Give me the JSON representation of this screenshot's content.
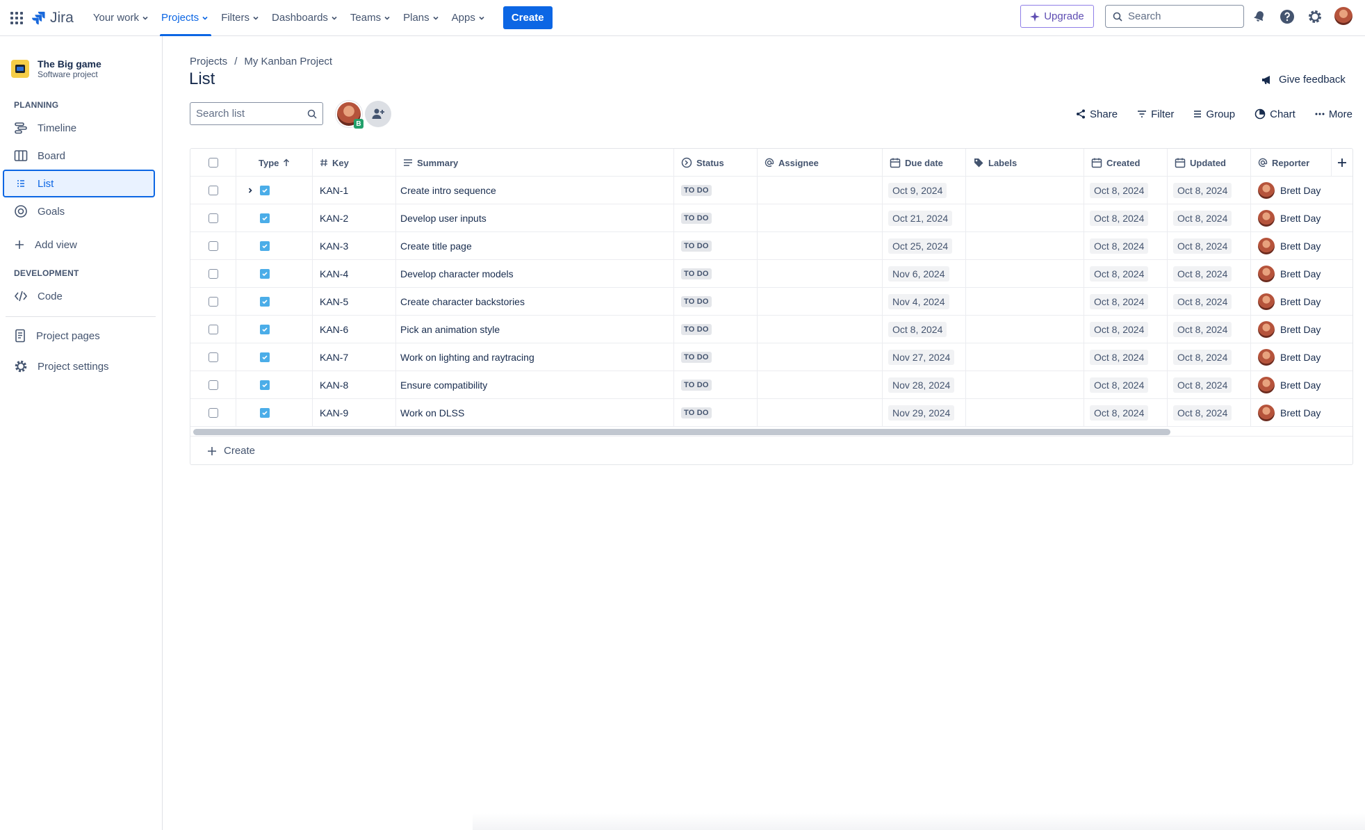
{
  "topnav": {
    "logo": "Jira",
    "items": [
      {
        "label": "Your work",
        "active": false
      },
      {
        "label": "Projects",
        "active": true
      },
      {
        "label": "Filters",
        "active": false
      },
      {
        "label": "Dashboards",
        "active": false
      },
      {
        "label": "Teams",
        "active": false
      },
      {
        "label": "Plans",
        "active": false
      },
      {
        "label": "Apps",
        "active": false
      }
    ],
    "create_label": "Create",
    "upgrade_label": "Upgrade",
    "search_placeholder": "Search"
  },
  "sidebar": {
    "project_name": "The Big game",
    "project_type": "Software project",
    "planning_heading": "PLANNING",
    "planning_items": [
      {
        "label": "Timeline",
        "icon": "timeline-icon"
      },
      {
        "label": "Board",
        "icon": "board-icon"
      },
      {
        "label": "List",
        "icon": "list-icon",
        "selected": true
      },
      {
        "label": "Goals",
        "icon": "goals-icon"
      }
    ],
    "add_view_label": "Add view",
    "development_heading": "DEVELOPMENT",
    "code_label": "Code",
    "project_pages_label": "Project pages",
    "project_settings_label": "Project settings"
  },
  "main": {
    "breadcrumb": [
      "Projects",
      "/",
      "My Kanban Project"
    ],
    "title": "List",
    "feedback_label": "Give feedback",
    "search_placeholder": "Search list",
    "avatar_badge": "B",
    "toolbar": [
      "Share",
      "Filter",
      "Group",
      "Chart",
      "More"
    ]
  },
  "table": {
    "columns": [
      "Type",
      "Key",
      "Summary",
      "Status",
      "Assignee",
      "Due date",
      "Labels",
      "Created",
      "Updated",
      "Reporter"
    ],
    "rows": [
      {
        "key": "KAN-1",
        "summary": "Create intro sequence",
        "status": "TO DO",
        "due": "Oct 9, 2024",
        "created": "Oct 8, 2024",
        "updated": "Oct 8, 2024",
        "reporter": "Brett Day"
      },
      {
        "key": "KAN-2",
        "summary": "Develop user inputs",
        "status": "TO DO",
        "due": "Oct 21, 2024",
        "created": "Oct 8, 2024",
        "updated": "Oct 8, 2024",
        "reporter": "Brett Day"
      },
      {
        "key": "KAN-3",
        "summary": "Create title page",
        "status": "TO DO",
        "due": "Oct 25, 2024",
        "created": "Oct 8, 2024",
        "updated": "Oct 8, 2024",
        "reporter": "Brett Day"
      },
      {
        "key": "KAN-4",
        "summary": "Develop character models",
        "status": "TO DO",
        "due": "Nov 6, 2024",
        "created": "Oct 8, 2024",
        "updated": "Oct 8, 2024",
        "reporter": "Brett Day"
      },
      {
        "key": "KAN-5",
        "summary": "Create character backstories",
        "status": "TO DO",
        "due": "Nov 4, 2024",
        "created": "Oct 8, 2024",
        "updated": "Oct 8, 2024",
        "reporter": "Brett Day"
      },
      {
        "key": "KAN-6",
        "summary": "Pick an animation style",
        "status": "TO DO",
        "due": "Oct 8, 2024",
        "created": "Oct 8, 2024",
        "updated": "Oct 8, 2024",
        "reporter": "Brett Day"
      },
      {
        "key": "KAN-7",
        "summary": "Work on lighting and raytracing",
        "status": "TO DO",
        "due": "Nov 27, 2024",
        "created": "Oct 8, 2024",
        "updated": "Oct 8, 2024",
        "reporter": "Brett Day"
      },
      {
        "key": "KAN-8",
        "summary": "Ensure compatibility",
        "status": "TO DO",
        "due": "Nov 28, 2024",
        "created": "Oct 8, 2024",
        "updated": "Oct 8, 2024",
        "reporter": "Brett Day"
      },
      {
        "key": "KAN-9",
        "summary": "Work on DLSS",
        "status": "TO DO",
        "due": "Nov 29, 2024",
        "created": "Oct 8, 2024",
        "updated": "Oct 8, 2024",
        "reporter": "Brett Day"
      }
    ],
    "create_label": "Create"
  },
  "colors": {
    "brand": "#0c66e4",
    "upgrade": "#5e4db2",
    "task": "#4bade8",
    "project_icon": "#f5cd47"
  }
}
